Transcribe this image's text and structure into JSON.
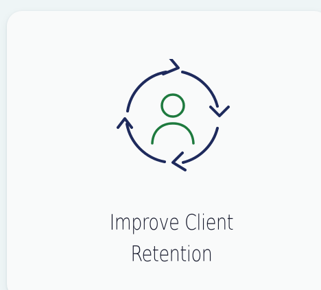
{
  "card": {
    "title_line1": "Improve Client",
    "title_line2": "Retention",
    "icon": "client-retention-cycle-icon"
  },
  "colors": {
    "page_background": "#eef5f6",
    "card_background": "#f9fafa",
    "cycle_stroke": "#1e2a5c",
    "person_stroke": "#1e7a3e",
    "text": "#15182b"
  }
}
